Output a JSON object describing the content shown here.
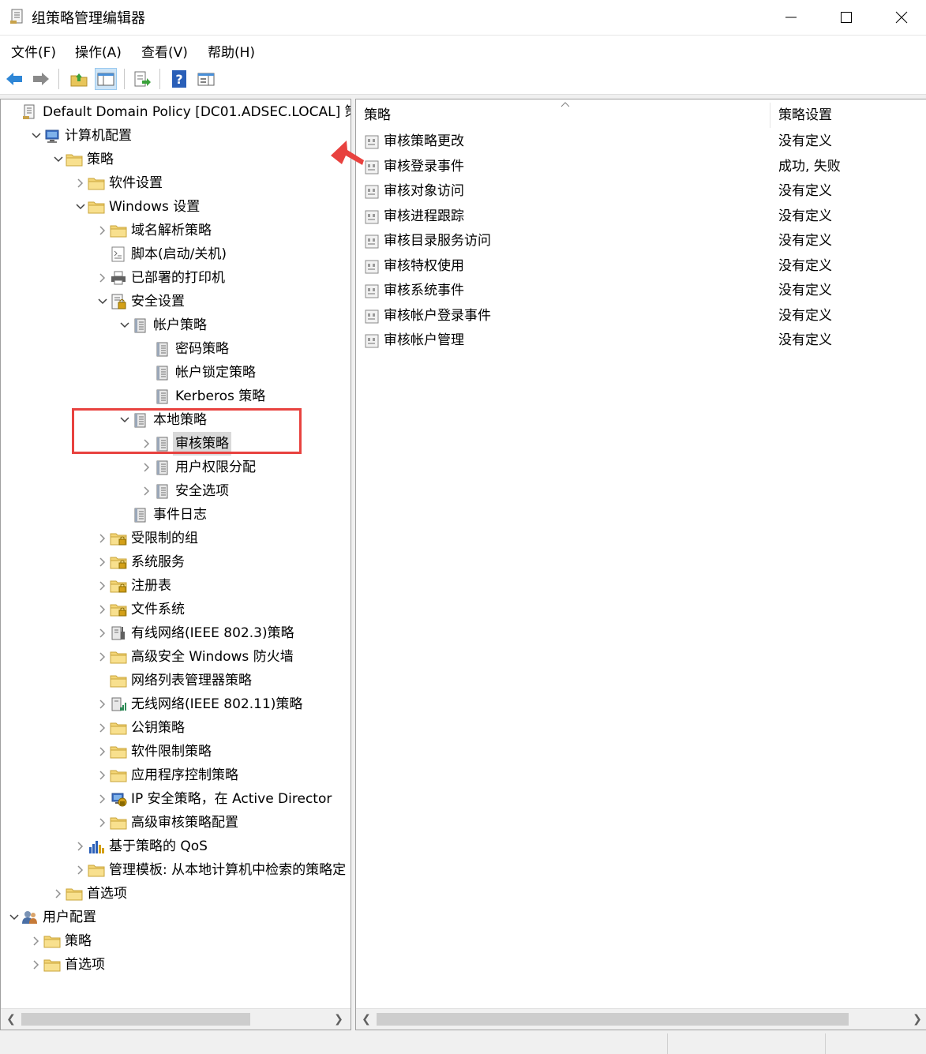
{
  "window": {
    "title": "组策略管理编辑器",
    "icon": "policy-scroll-icon",
    "controls": [
      "minimize-icon",
      "maximize-icon",
      "close-icon"
    ]
  },
  "menubar": {
    "items": [
      "文件(F)",
      "操作(A)",
      "查看(V)",
      "帮助(H)"
    ]
  },
  "toolbar": {
    "buttons": [
      "back-arrow-icon",
      "forward-arrow-icon",
      "up-folder-icon",
      "show-hide-tree-icon",
      "export-list-icon",
      "help-icon",
      "properties-pane-icon"
    ]
  },
  "tree": {
    "rows": [
      {
        "label": "Default Domain Policy [DC01.ADSEC.LOCAL] 策",
        "icon": "policy-doc",
        "expander": ""
      },
      {
        "label": "计算机配置",
        "icon": "computer",
        "expander": "open"
      },
      {
        "label": "策略",
        "icon": "folder",
        "expander": "open"
      },
      {
        "label": "软件设置",
        "icon": "folder",
        "expander": "closed"
      },
      {
        "label": "Windows 设置",
        "icon": "folder",
        "expander": "open"
      },
      {
        "label": "域名解析策略",
        "icon": "folder",
        "expander": "closed"
      },
      {
        "label": "脚本(启动/关机)",
        "icon": "script",
        "expander": ""
      },
      {
        "label": "已部署的打印机",
        "icon": "printer",
        "expander": "closed"
      },
      {
        "label": "安全设置",
        "icon": "security",
        "expander": "open"
      },
      {
        "label": "帐户策略",
        "icon": "policy-book",
        "expander": "open"
      },
      {
        "label": "密码策略",
        "icon": "policy-book",
        "expander": ""
      },
      {
        "label": "帐户锁定策略",
        "icon": "policy-book",
        "expander": ""
      },
      {
        "label": "Kerberos 策略",
        "icon": "policy-book",
        "expander": ""
      },
      {
        "label": "本地策略",
        "icon": "policy-book",
        "expander": "open"
      },
      {
        "label": "审核策略",
        "icon": "policy-book",
        "expander": "closed",
        "selected": true
      },
      {
        "label": "用户权限分配",
        "icon": "policy-book",
        "expander": "closed"
      },
      {
        "label": "安全选项",
        "icon": "policy-book",
        "expander": "closed"
      },
      {
        "label": "事件日志",
        "icon": "policy-book",
        "expander": ""
      },
      {
        "label": "受限制的组",
        "icon": "folder-lock",
        "expander": "closed"
      },
      {
        "label": "系统服务",
        "icon": "folder-lock",
        "expander": "closed"
      },
      {
        "label": "注册表",
        "icon": "folder-lock",
        "expander": "closed"
      },
      {
        "label": "文件系统",
        "icon": "folder-lock",
        "expander": "closed"
      },
      {
        "label": "有线网络(IEEE 802.3)策略",
        "icon": "wired-network",
        "expander": "closed"
      },
      {
        "label": "高级安全 Windows 防火墙",
        "icon": "folder",
        "expander": "closed"
      },
      {
        "label": "网络列表管理器策略",
        "icon": "folder",
        "expander": ""
      },
      {
        "label": "无线网络(IEEE 802.11)策略",
        "icon": "wireless-network",
        "expander": "closed"
      },
      {
        "label": "公钥策略",
        "icon": "folder",
        "expander": "closed"
      },
      {
        "label": "软件限制策略",
        "icon": "folder",
        "expander": "closed"
      },
      {
        "label": "应用程序控制策略",
        "icon": "folder",
        "expander": "closed"
      },
      {
        "label": "IP 安全策略，在 Active Director",
        "icon": "ip-security",
        "expander": "closed"
      },
      {
        "label": "高级审核策略配置",
        "icon": "folder",
        "expander": "closed"
      },
      {
        "label": "基于策略的 QoS",
        "icon": "qos-chart",
        "expander": "closed"
      },
      {
        "label": "管理模板: 从本地计算机中检索的策略定",
        "icon": "folder",
        "expander": "closed"
      },
      {
        "label": "首选项",
        "icon": "folder",
        "expander": "closed"
      },
      {
        "label": "用户配置",
        "icon": "users",
        "expander": "open"
      },
      {
        "label": "策略",
        "icon": "folder",
        "expander": "closed"
      },
      {
        "label": "首选项",
        "icon": "folder",
        "expander": "closed"
      }
    ]
  },
  "list": {
    "columns": [
      "策略",
      "策略设置"
    ],
    "rows": [
      {
        "name": "审核策略更改",
        "value": "没有定义"
      },
      {
        "name": "审核登录事件",
        "value": "成功, 失败"
      },
      {
        "name": "审核对象访问",
        "value": "没有定义"
      },
      {
        "name": "审核进程跟踪",
        "value": "没有定义"
      },
      {
        "name": "审核目录服务访问",
        "value": "没有定义"
      },
      {
        "name": "审核特权使用",
        "value": "没有定义"
      },
      {
        "name": "审核系统事件",
        "value": "没有定义"
      },
      {
        "name": "审核帐户登录事件",
        "value": "没有定义"
      },
      {
        "name": "审核帐户管理",
        "value": "没有定义"
      }
    ]
  },
  "annotations": {
    "highlight_color": "#e8423f"
  }
}
